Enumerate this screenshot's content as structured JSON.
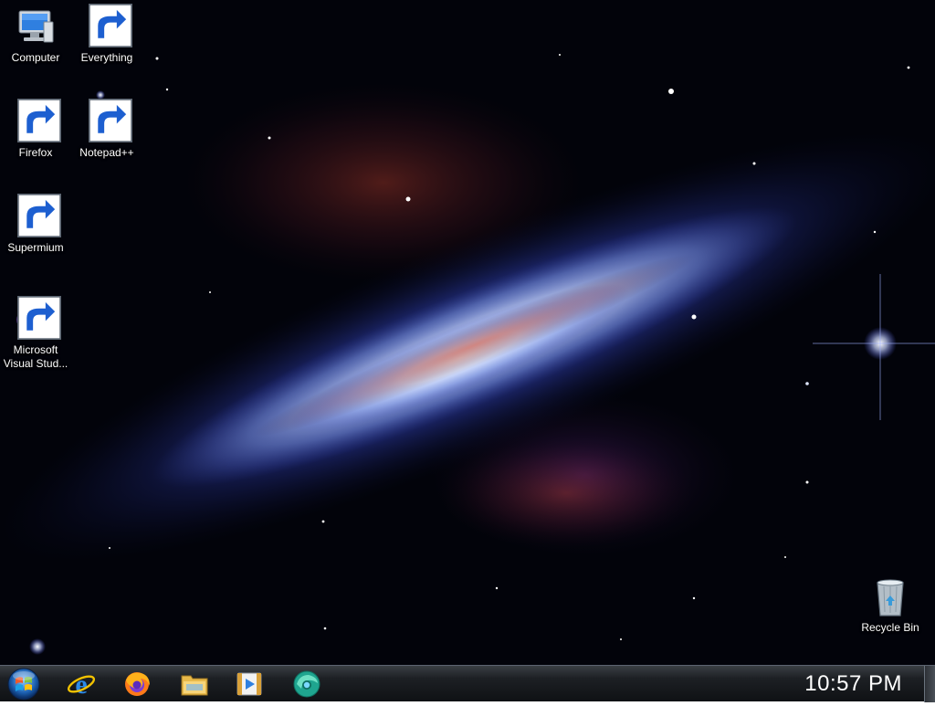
{
  "desktop": {
    "icons": [
      {
        "label": "Computer",
        "icon": "computer-icon"
      },
      {
        "label": "Everything",
        "icon": "everything-icon"
      },
      {
        "label": "Firefox",
        "icon": "firefox-icon"
      },
      {
        "label": "Notepad++",
        "icon": "notepad-plus-plus-icon"
      },
      {
        "label": "Supermium",
        "icon": "supermium-icon"
      },
      {
        "label": "Microsoft Visual Stud...",
        "icon": "visual-studio-icon"
      },
      {
        "label": "Recycle Bin",
        "icon": "recycle-bin-icon"
      }
    ]
  },
  "taskbar": {
    "start": {
      "icon": "windows-start-orb-icon"
    },
    "pinned": [
      {
        "icon": "internet-explorer-icon"
      },
      {
        "icon": "firefox-icon"
      },
      {
        "icon": "file-explorer-icon"
      },
      {
        "icon": "media-player-icon"
      },
      {
        "icon": "supermium-icon"
      }
    ],
    "clock": "10:57 PM"
  },
  "colors": {
    "taskbar": "#1d2024",
    "galaxy_core": "#e8f0ff",
    "galaxy_blue": "#4a6ad8",
    "galaxy_red": "#a0302a",
    "space": "#02030a"
  }
}
